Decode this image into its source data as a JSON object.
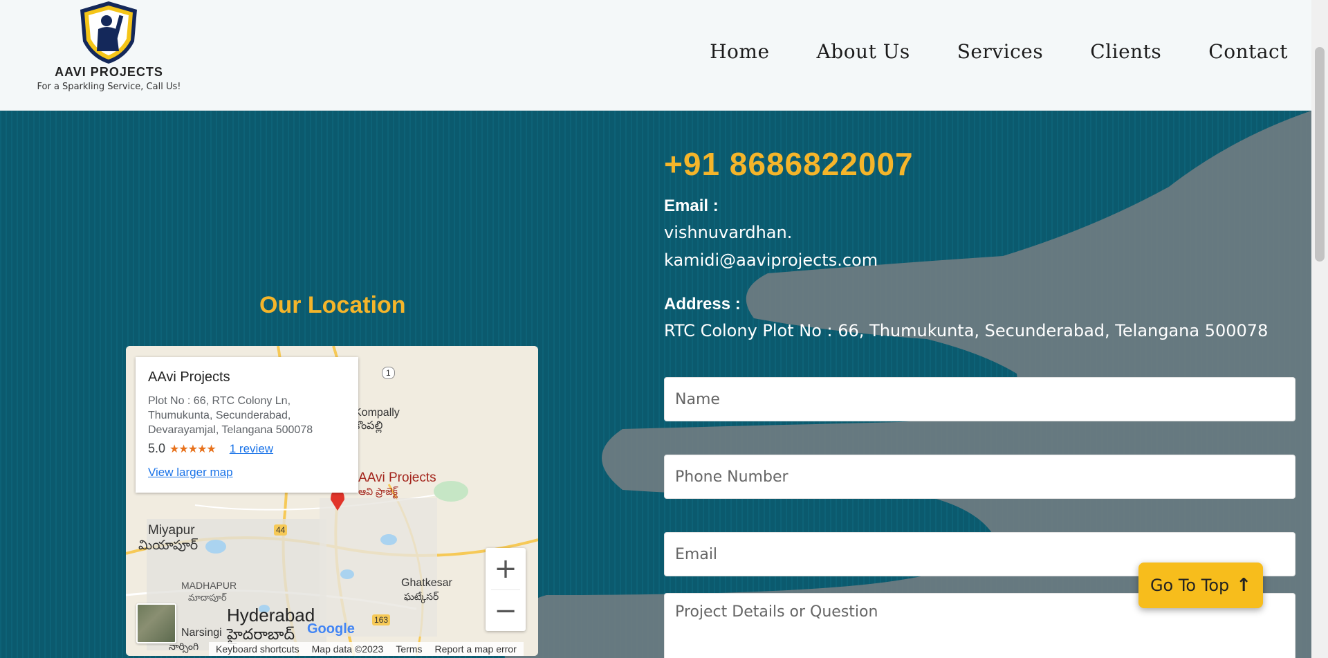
{
  "brand": {
    "name": "AAVI PROJECTS",
    "tagline": "For a Sparkling Service, Call Us!",
    "colors": {
      "accent": "#f5b52a",
      "navy": "#14285a",
      "teal": "#0b5a6e"
    }
  },
  "nav": {
    "items": [
      {
        "label": "Home"
      },
      {
        "label": "About Us"
      },
      {
        "label": "Services"
      },
      {
        "label": "Clients"
      },
      {
        "label": "Contact"
      }
    ]
  },
  "location": {
    "title": "Our Location",
    "map": {
      "place_name": "AAvi Projects",
      "address": "Plot No : 66, RTC Colony Ln, Thumukunta, Secunderabad, Devarayamjal, Telangana 500078",
      "rating": "5.0",
      "stars": "★★★★★",
      "reviews": "1 review",
      "larger_map": "View larger map",
      "pin_label": "AAvi Projects",
      "pin_label_te": "ఆవి ప్రాజెక్ట్",
      "labels": {
        "kompally": "Kompally",
        "kompally_te": "కొంపల్లి",
        "miyapur": "Miyapur",
        "miyapur_te": "మియాపూర్",
        "madhapur": "MADHAPUR",
        "madhapur_te": "మాదాపూర్",
        "hyderabad": "Hyderabad",
        "hyderabad_te": "హైదరాబాద్",
        "ghatkesar": "Ghatkesar",
        "ghatkesar_te": "ఘట్కేసర్",
        "narsingi": "Narsingi",
        "narsingi_te": "నార్సింగి",
        "highway_44": "44",
        "highway_163": "163",
        "highway_1": "1"
      },
      "zoom_in": "+",
      "zoom_out": "−",
      "google": "Google",
      "footer": {
        "shortcuts": "Keyboard shortcuts",
        "map_data": "Map data ©2023",
        "terms": "Terms",
        "report": "Report a map error"
      }
    }
  },
  "contact": {
    "phone": "+91 8686822007",
    "email_label": "Email :",
    "email_line1": "vishnuvardhan.",
    "email_line2": "kamidi@aaviprojects.com",
    "address_label": "Address :",
    "address": "RTC Colony Plot No : 66, Thumukunta, Secunderabad, Telangana 500078"
  },
  "form": {
    "name_placeholder": "Name",
    "phone_placeholder": "Phone Number",
    "email_placeholder": "Email",
    "details_placeholder": "Project Details or Question"
  },
  "go_to_top": {
    "label": "Go To Top",
    "arrow": "↑"
  }
}
